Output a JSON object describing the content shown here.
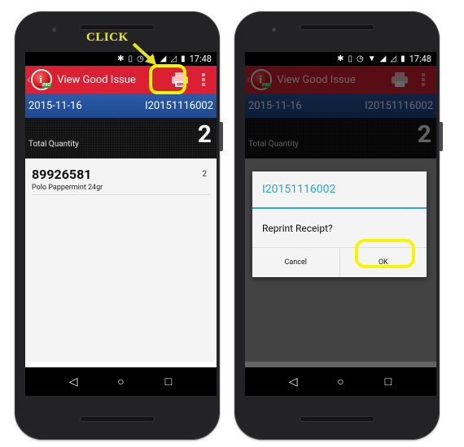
{
  "annotation": {
    "click_label": "CLICK",
    "highlight_color": "#f5f500"
  },
  "status_bar": {
    "time": "17:48",
    "icons": [
      "bluetooth-icon",
      "vibrate-icon",
      "alarm-icon",
      "wifi-icon",
      "signal-icon",
      "signal-empty-icon",
      "battery-charging-icon"
    ]
  },
  "app": {
    "title": "View Good Issue",
    "back_glyph": "‹",
    "logo_letter": "i",
    "logo_badge": "PRO",
    "accent_color": "#dc2033",
    "band_color": "#2d5aa8"
  },
  "document": {
    "date": "2015-11-16",
    "number": "I20151116002",
    "total_label": "Total Quantity",
    "total_value": "2"
  },
  "items": [
    {
      "code": "89926581",
      "name": "Polo Pappermint 24gr",
      "qty": "2"
    }
  ],
  "dialog": {
    "title": "I20151116002",
    "message": "Reprint Receipt?",
    "cancel_label": "Cancel",
    "ok_label": "OK",
    "title_color": "#2aa6dc"
  },
  "navbar": {
    "back": "◁",
    "home": "○",
    "recents": "□"
  }
}
